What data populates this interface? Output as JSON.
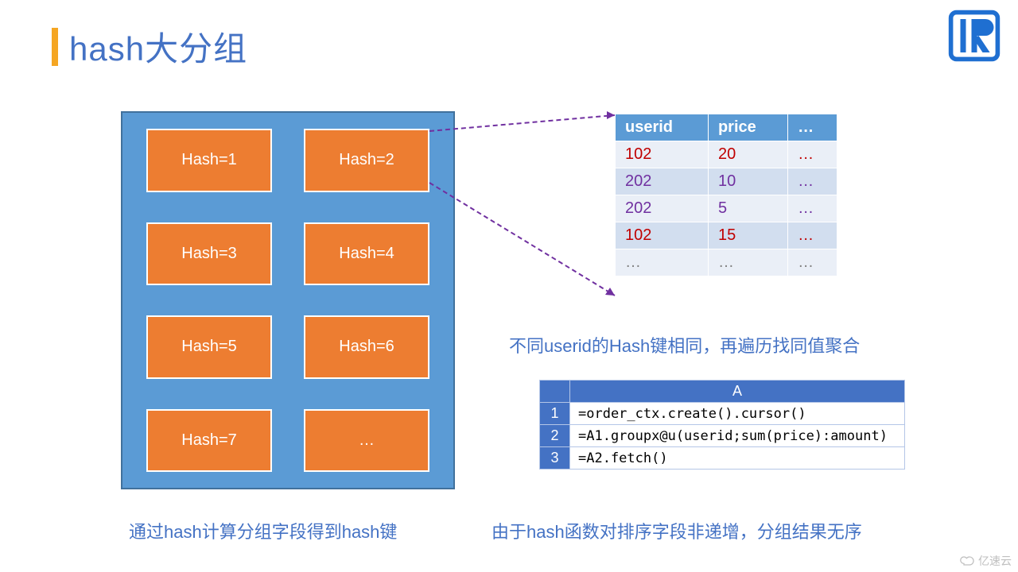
{
  "title": "hash大分组",
  "hash_cells": [
    "Hash=1",
    "Hash=2",
    "Hash=3",
    "Hash=4",
    "Hash=5",
    "Hash=6",
    "Hash=7",
    "…"
  ],
  "data_table": {
    "headers": [
      "userid",
      "price",
      "…"
    ],
    "rows": [
      {
        "userid": "102",
        "price": "20",
        "etc": "…",
        "cls": "red-text"
      },
      {
        "userid": "202",
        "price": "10",
        "etc": "…",
        "cls": "purple-text"
      },
      {
        "userid": "202",
        "price": "5",
        "etc": "…",
        "cls": "purple-text"
      },
      {
        "userid": "102",
        "price": "15",
        "etc": "…",
        "cls": "red-text"
      },
      {
        "userid": "…",
        "price": "…",
        "etc": "…",
        "cls": "gray-text"
      }
    ]
  },
  "caption1": "不同userid的Hash键相同，再遍历找同值聚合",
  "caption2": "通过hash计算分组字段得到hash键",
  "caption3": "由于hash函数对排序字段非递增，分组结果无序",
  "code_table": {
    "header": "A",
    "rows": [
      "=order_ctx.create().cursor()",
      "=A1.groupx@u(userid;sum(price):amount)",
      "=A2.fetch()"
    ]
  },
  "watermark": "亿速云"
}
